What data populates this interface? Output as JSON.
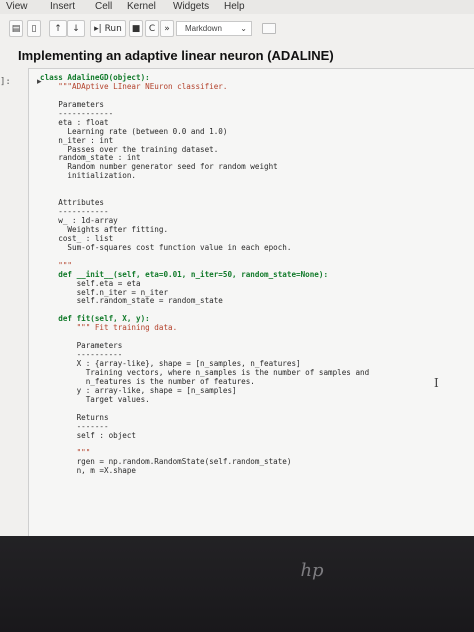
{
  "menu": {
    "items": [
      "View",
      "Insert",
      "Cell",
      "Kernel",
      "Widgets",
      "Help"
    ]
  },
  "toolbar": {
    "run_label": "Run",
    "cell_type": "Markdown"
  },
  "heading": "Implementing an adaptive linear neuron (ADALINE)",
  "cell": {
    "prompt": "]:",
    "code_lines": [
      "class AdalineGD(object):",
      "    \"\"\"ADAptive LInear NEuron classifier.",
      "",
      "    Parameters",
      "    ------------",
      "    eta : float",
      "      Learning rate (between 0.0 and 1.0)",
      "    n_iter : int",
      "      Passes over the training dataset.",
      "    random_state : int",
      "      Random number generator seed for random weight",
      "      initialization.",
      "",
      "",
      "    Attributes",
      "    -----------",
      "    w_ : 1d-array",
      "      Weights after fitting.",
      "    cost_ : list",
      "      Sum-of-squares cost function value in each epoch.",
      "",
      "    \"\"\"",
      "    def __init__(self, eta=0.01, n_iter=50, random_state=None):",
      "        self.eta = eta",
      "        self.n_iter = n_iter",
      "        self.random_state = random_state",
      "",
      "    def fit(self, X, y):",
      "        \"\"\" Fit training data.",
      "",
      "        Parameters",
      "        ----------",
      "        X : {array-like}, shape = [n_samples, n_features]",
      "          Training vectors, where n_samples is the number of samples and",
      "          n_features is the number of features.",
      "        y : array-like, shape = [n_samples]",
      "          Target values.",
      "",
      "        Returns",
      "        -------",
      "        self : object",
      "",
      "        \"\"\"",
      "        rgen = np.random.RandomState(self.random_state)",
      "        n, m =X.shape"
    ]
  },
  "icons": [
    "save-icon",
    "add-cell-icon",
    "move-up-icon",
    "move-down-icon",
    "run-icon",
    "stop-icon",
    "restart-icon",
    "fast-forward-icon",
    "keyboard-icon",
    "text-cursor-icon",
    "laptop-logo-icon"
  ]
}
